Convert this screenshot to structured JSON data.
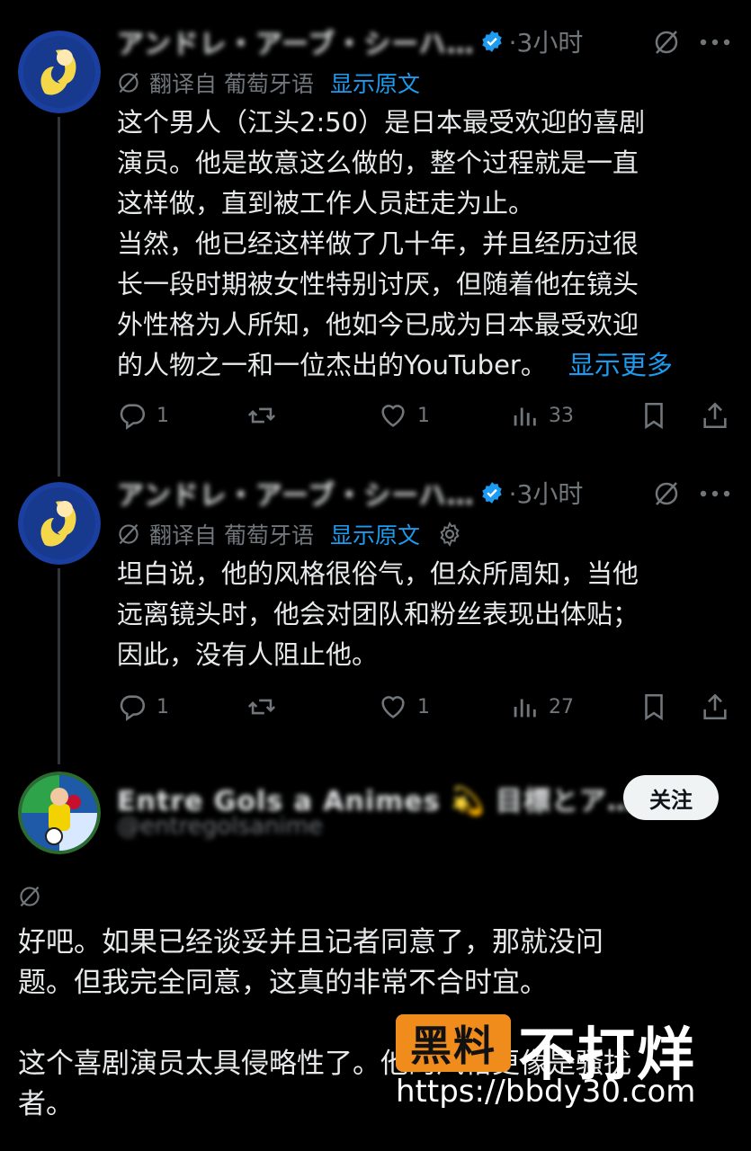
{
  "tweets": [
    {
      "author_name": "アンドレ・アーブ・シーハ…",
      "time": "·3小时",
      "translate_label": "翻译自 葡萄牙语",
      "show_original": "显示原文",
      "body_lines": [
        "这个男人（江头2:50）是日本最受欢迎的喜剧",
        "演员。他是故意这么做的，整个过程就是一直",
        "这样做，直到被工作人员赶走为止。",
        "当然，他已经这样做了几十年，并且经历过很",
        "长一段时期被女性特别讨厌，但随着他在镜头",
        "外性格为人所知，他如今已成为日本最受欢迎"
      ],
      "last_line": "的人物之一和一位杰出的YouTuber。",
      "show_more": "显示更多",
      "reply_count": "1",
      "like_count": "1",
      "view_count": "33"
    },
    {
      "author_name": "アンドレ・アーブ・シーハ…",
      "time": "·3小时",
      "translate_label": "翻译自 葡萄牙语",
      "show_original": "显示原文",
      "body_lines": [
        "坦白说，他的风格很俗气，但众所周知，当他",
        "远离镜头时，他会对团队和粉丝表现出体贴；",
        "因此，没有人阻止他。"
      ],
      "reply_count": "1",
      "like_count": "1",
      "view_count": "27"
    }
  ],
  "reply": {
    "author_name": "Entre Gols a Animes 💫 目標とア…",
    "handle": "@entregolsanime",
    "follow_label": "关注",
    "body_lines": [
      "好吧。如果已经谈妥并且记者同意了，那就没问",
      "题。但我完全同意，这真的非常不合时宜。",
      "",
      "这个喜剧演员太具侵略性了。他的风格更像是骚扰",
      "者。"
    ]
  },
  "watermark": {
    "badge": "黑料",
    "title": "不打烊",
    "url": "https://bbdy30.com"
  },
  "colors": {
    "background": "#000000",
    "text": "#e7e9ea",
    "muted": "#71767b",
    "accent": "#1d9bf0",
    "watermark_orange": "#f08c1c"
  },
  "icons": [
    "translate-slash-icon",
    "more-icon",
    "reply-icon",
    "retweet-icon",
    "like-icon",
    "views-icon",
    "bookmark-icon",
    "share-icon",
    "verified-icon",
    "gear-icon"
  ]
}
